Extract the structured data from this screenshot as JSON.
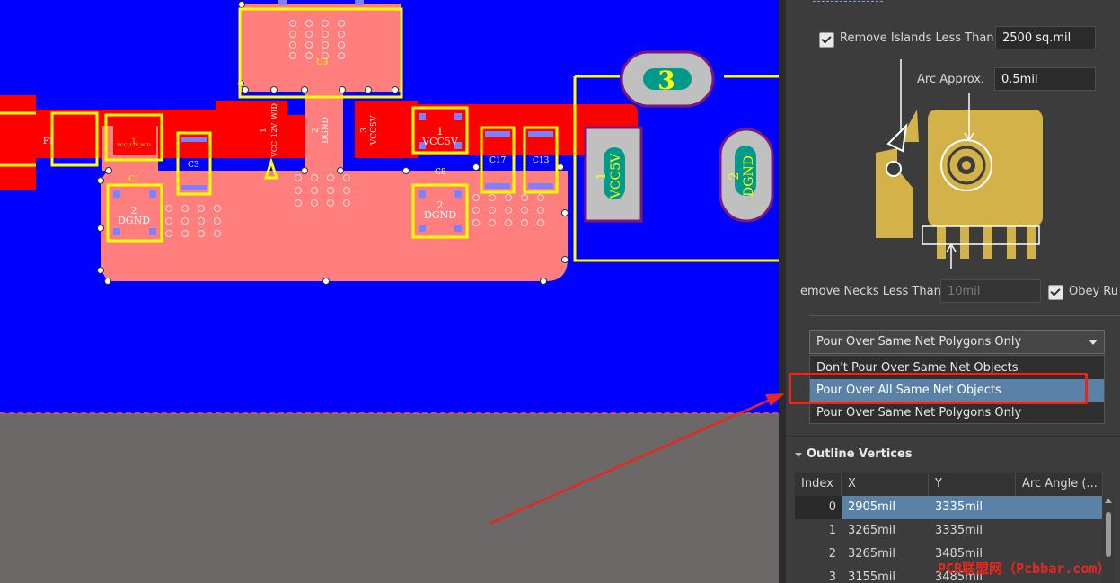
{
  "canvas": {
    "labels": {
      "f1": "F1",
      "c1": "C1",
      "c3": "C3",
      "c8": "C8",
      "c17": "C17",
      "c13": "C13",
      "u3": "U3",
      "pad1_net": "VCC_12V_WID",
      "pad_dgnd_c1": "DGND",
      "pad_dgnd_c8": "DGND",
      "pad_vcc12v": "VCC_12V_WID",
      "pad_dgnd_mid": "DGND",
      "pad_vcc5v_a": "VCC5V",
      "pad_vcc5v_b": "VCC5V",
      "pad_vcc5v_big": "VCC5V",
      "pad_dgnd_big": "DGND",
      "pin3": "3",
      "pin1": "1",
      "pin2": "2",
      "pinA": "1",
      "pinB": "2",
      "pinC": "3",
      "pinD": "1",
      "pinE": "2"
    },
    "colors": {
      "board": "#0000ff",
      "background": "#6d6868",
      "copper": "#ff0000",
      "polygon": "#ff7f7f",
      "silk": "#ffff00"
    }
  },
  "panel": {
    "remove_islands": {
      "label": "Remove Islands Less Than",
      "value": "2500 sq.mil",
      "checked": true
    },
    "arc_approx": {
      "label": "Arc Approx.",
      "value": "0.5mil"
    },
    "remove_necks": {
      "label": "emove Necks Less Than",
      "value": "10mil"
    },
    "obey_rules": {
      "label": "Obey Ru",
      "checked": true
    },
    "pour_mode": {
      "selected": "Pour Over Same Net Polygons Only",
      "options": [
        "Don't Pour Over Same Net Objects",
        "Pour Over All Same Net Objects",
        "Pour Over Same Net Polygons Only"
      ],
      "highlighted_index": 1
    },
    "outline_vertices": {
      "title": "Outline Vertices",
      "columns": [
        "Index",
        "X",
        "Y",
        "Arc Angle (..."
      ],
      "rows": [
        {
          "index": "0",
          "x": "2905mil",
          "y": "3335mil"
        },
        {
          "index": "1",
          "x": "3265mil",
          "y": "3335mil"
        },
        {
          "index": "2",
          "x": "3265mil",
          "y": "3485mil"
        },
        {
          "index": "3",
          "x": "3155mil",
          "y": "3485mil"
        }
      ]
    }
  },
  "watermark": "PCB联盟网（Pcbbar.com）"
}
